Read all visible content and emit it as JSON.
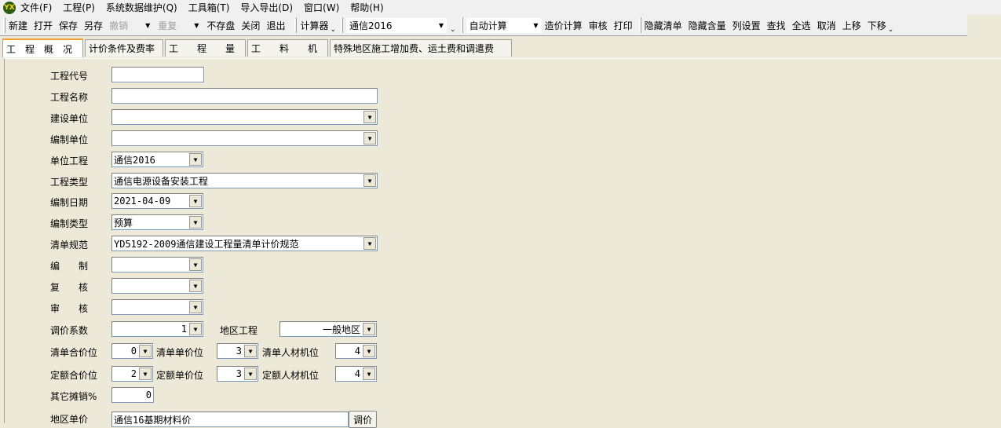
{
  "menu": [
    "文件(F)",
    "工程(P)",
    "系统数据维护(Q)",
    "工具箱(T)",
    "导入导出(D)",
    "窗口(W)",
    "帮助(H)"
  ],
  "logo": "YX",
  "toolbar": {
    "new": "新建",
    "open": "打开",
    "save": "保存",
    "save_as": "另存",
    "undo": "撤销",
    "redo": "重复",
    "no_save": "不存盘",
    "close": "关闭",
    "exit": "退出",
    "calculator": "计算器",
    "profession": "通信2016",
    "calc_mode": "自动计算",
    "cost_calc": "造价计算",
    "review": "审核",
    "print": "打印",
    "hide_list": "隐藏清单",
    "hide_content": "隐藏含量",
    "column_settings": "列设置",
    "find": "查找",
    "select_all": "全选",
    "cancel": "取消",
    "move_up": "上移",
    "move_down": "下移"
  },
  "tabs": [
    "工　程　概　况",
    "计价条件及费率",
    "工　　程　　量",
    "工　　料　　机",
    "特殊地区施工增加费、运土费和调遣费"
  ],
  "form": {
    "project_code": {
      "label": "工程代号",
      "value": ""
    },
    "project_name": {
      "label": "工程名称",
      "value": ""
    },
    "construction_unit": {
      "label": "建设单位",
      "value": ""
    },
    "compiling_unit": {
      "label": "编制单位",
      "value": ""
    },
    "unit_project": {
      "label": "单位工程",
      "value": "通信2016"
    },
    "project_type": {
      "label": "工程类型",
      "value": "通信电源设备安装工程"
    },
    "compile_date": {
      "label": "编制日期",
      "value": "2021-04-09"
    },
    "compile_type": {
      "label": "编制类型",
      "value": "预算"
    },
    "bill_spec": {
      "label": "清单规范",
      "value": "YD5192-2009通信建设工程量清单计价规范"
    },
    "compiler": {
      "label": "编　　制",
      "value": ""
    },
    "checker": {
      "label": "复　　核",
      "value": ""
    },
    "auditor": {
      "label": "审　　核",
      "value": ""
    },
    "price_adjust": {
      "label": "调价系数",
      "value": "1"
    },
    "region_project": {
      "label": "地区工程",
      "value": "一般地区"
    },
    "bill_total_digits": {
      "label": "清单合价位",
      "value": "0"
    },
    "bill_unit_digits": {
      "label": "清单单价位",
      "value": "3"
    },
    "bill_lmm_digits": {
      "label": "清单人材机位",
      "value": "4"
    },
    "quota_total_digits": {
      "label": "定额合价位",
      "value": "2"
    },
    "quota_unit_digits": {
      "label": "定额单价位",
      "value": "3"
    },
    "quota_lmm_digits": {
      "label": "定额人材机位",
      "value": "4"
    },
    "other_amort": {
      "label": "其它摊销%",
      "value": "0"
    },
    "region_price": {
      "label": "地区单价",
      "value": "通信16基期材料价",
      "button": "调价"
    }
  }
}
